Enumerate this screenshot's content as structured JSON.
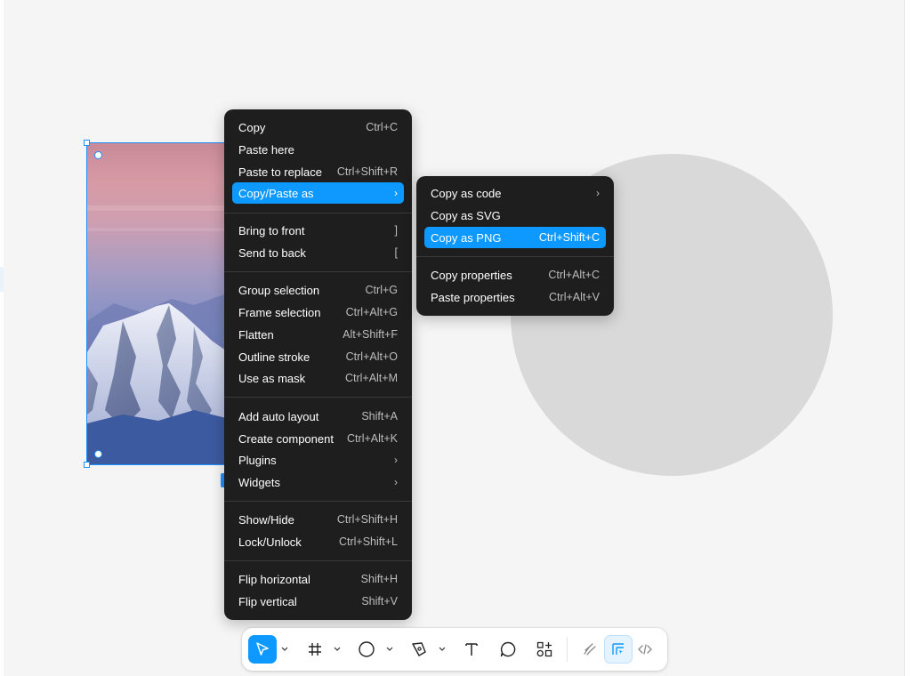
{
  "main_menu": {
    "items": [
      {
        "label": "Copy",
        "shortcut": "Ctrl+C"
      },
      {
        "label": "Paste here",
        "shortcut": ""
      },
      {
        "label": "Paste to replace",
        "shortcut": "Ctrl+Shift+R"
      },
      {
        "label": "Copy/Paste as",
        "shortcut": "›"
      },
      {
        "label": "Bring to front",
        "shortcut": "]"
      },
      {
        "label": "Send to back",
        "shortcut": "["
      },
      {
        "label": "Group selection",
        "shortcut": "Ctrl+G"
      },
      {
        "label": "Frame selection",
        "shortcut": "Ctrl+Alt+G"
      },
      {
        "label": "Flatten",
        "shortcut": "Alt+Shift+F"
      },
      {
        "label": "Outline stroke",
        "shortcut": "Ctrl+Alt+O"
      },
      {
        "label": "Use as mask",
        "shortcut": "Ctrl+Alt+M"
      },
      {
        "label": "Add auto layout",
        "shortcut": "Shift+A"
      },
      {
        "label": "Create component",
        "shortcut": "Ctrl+Alt+K"
      },
      {
        "label": "Plugins",
        "shortcut": "›"
      },
      {
        "label": "Widgets",
        "shortcut": "›"
      },
      {
        "label": "Show/Hide",
        "shortcut": "Ctrl+Shift+H"
      },
      {
        "label": "Lock/Unlock",
        "shortcut": "Ctrl+Shift+L"
      },
      {
        "label": "Flip horizontal",
        "shortcut": "Shift+H"
      },
      {
        "label": "Flip vertical",
        "shortcut": "Shift+V"
      }
    ]
  },
  "sub_menu": {
    "items": [
      {
        "label": "Copy as code",
        "shortcut": "›"
      },
      {
        "label": "Copy as SVG",
        "shortcut": ""
      },
      {
        "label": "Copy as PNG",
        "shortcut": "Ctrl+Shift+C"
      },
      {
        "label": "Copy properties",
        "shortcut": "Ctrl+Alt+C"
      },
      {
        "label": "Paste properties",
        "shortcut": "Ctrl+Alt+V"
      }
    ]
  },
  "toolbar": {
    "tools": [
      "move-tool",
      "frame-tool",
      "shape-tool",
      "pen-tool",
      "text-tool",
      "comment-tool",
      "actions-tool",
      "draw-mode",
      "design-mode",
      "dev-mode"
    ],
    "active_tool": "move-tool"
  },
  "colors": {
    "accent": "#0d99ff",
    "menu_bg": "#1e1e1e",
    "canvas_bg": "#f5f5f5",
    "circle_fill": "#d9d9d9"
  }
}
